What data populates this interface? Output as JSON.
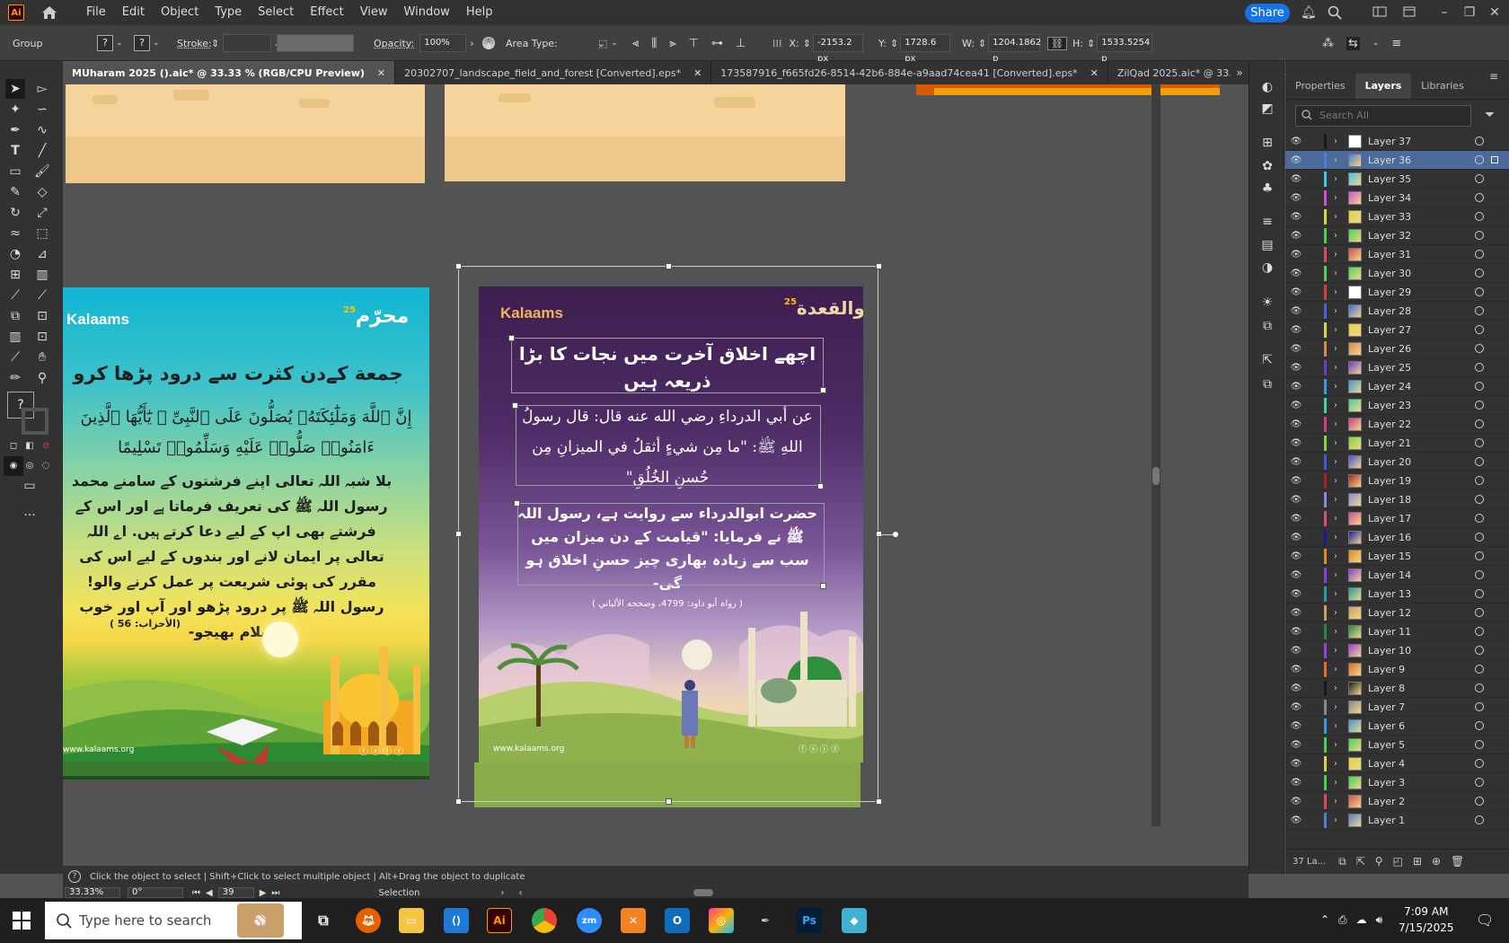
{
  "app": {
    "logo": "Ai",
    "share_label": "Share"
  },
  "menu": [
    "File",
    "Edit",
    "Object",
    "Type",
    "Select",
    "Effect",
    "View",
    "Window",
    "Help"
  ],
  "control": {
    "selection_type": "Group",
    "stroke_label": "Stroke:",
    "opacity_label": "Opacity:",
    "opacity_value": "100%",
    "area_type_label": "Area Type:",
    "x_label": "X:",
    "x_value": "-2153.2 px",
    "y_label": "Y:",
    "y_value": "1728.6 px",
    "w_label": "W:",
    "w_value": "1204.1862 p",
    "h_label": "H:",
    "h_value": "1533.5254 p"
  },
  "tabs": [
    {
      "label": "MUharam 2025 ().aic* @ 33.33 % (RGB/CPU Preview)",
      "active": true
    },
    {
      "label": "20302707_landscape_field_and_forest [Converted].eps*",
      "active": false
    },
    {
      "label": "173587916_f665fd26-8514-42b6-884e-a9aad74cea41 [Converted].eps*",
      "active": false
    },
    {
      "label": "ZilQad 2025.aic* @ 33.33 % (RGB/CPU",
      "active": false
    }
  ],
  "panel": {
    "tabs": [
      "Properties",
      "Layers",
      "Libraries"
    ],
    "active_tab": "Layers",
    "search_placeholder": "Search All",
    "footer_count": "37 La...",
    "layers": [
      {
        "name": "Layer 37",
        "color": "#1a1a1a",
        "selected": false
      },
      {
        "name": "Layer 36",
        "color": "#4f7fd6",
        "selected": true
      },
      {
        "name": "Layer 35",
        "color": "#3ec7e0",
        "selected": false
      },
      {
        "name": "Layer 34",
        "color": "#d64fd6",
        "selected": false
      },
      {
        "name": "Layer 33",
        "color": "#e0d23e",
        "selected": false
      },
      {
        "name": "Layer 32",
        "color": "#3ed64f",
        "selected": false
      },
      {
        "name": "Layer 31",
        "color": "#d64f4f",
        "selected": false
      },
      {
        "name": "Layer 30",
        "color": "#4fd64f",
        "selected": false
      },
      {
        "name": "Layer 29",
        "color": "#d63e3e",
        "selected": false
      },
      {
        "name": "Layer 28",
        "color": "#3e6ad6",
        "selected": false
      },
      {
        "name": "Layer 27",
        "color": "#e0d23e",
        "selected": false
      },
      {
        "name": "Layer 26",
        "color": "#d6884f",
        "selected": false
      },
      {
        "name": "Layer 25",
        "color": "#6a3ed6",
        "selected": false
      },
      {
        "name": "Layer 24",
        "color": "#3e9ad6",
        "selected": false
      },
      {
        "name": "Layer 23",
        "color": "#3ed6a0",
        "selected": false
      },
      {
        "name": "Layer 22",
        "color": "#d63e88",
        "selected": false
      },
      {
        "name": "Layer 21",
        "color": "#7ad63e",
        "selected": false
      },
      {
        "name": "Layer 20",
        "color": "#3e5ad6",
        "selected": false
      },
      {
        "name": "Layer 19",
        "color": "#b02020",
        "selected": false
      },
      {
        "name": "Layer 18",
        "color": "#8888e0",
        "selected": false
      },
      {
        "name": "Layer 17",
        "color": "#d64f88",
        "selected": false
      },
      {
        "name": "Layer 16",
        "color": "#1a1aa0",
        "selected": false
      },
      {
        "name": "Layer 15",
        "color": "#e08a20",
        "selected": false
      },
      {
        "name": "Layer 14",
        "color": "#8a3ed6",
        "selected": false
      },
      {
        "name": "Layer 13",
        "color": "#20a0a0",
        "selected": false
      },
      {
        "name": "Layer 12",
        "color": "#c8a060",
        "selected": false
      },
      {
        "name": "Layer 11",
        "color": "#208a40",
        "selected": false
      },
      {
        "name": "Layer 10",
        "color": "#a03ed6",
        "selected": false
      },
      {
        "name": "Layer 9",
        "color": "#e07020",
        "selected": false
      },
      {
        "name": "Layer 8",
        "color": "#1a1a1a",
        "selected": false
      },
      {
        "name": "Layer 7",
        "color": "#888888",
        "selected": false
      },
      {
        "name": "Layer 6",
        "color": "#3e9ad6",
        "selected": false
      },
      {
        "name": "Layer 5",
        "color": "#3ed64f",
        "selected": false
      },
      {
        "name": "Layer 4",
        "color": "#e0d23e",
        "selected": false
      },
      {
        "name": "Layer 3",
        "color": "#3ed64f",
        "selected": false
      },
      {
        "name": "Layer 2",
        "color": "#d64f4f",
        "selected": false
      },
      {
        "name": "Layer 1",
        "color": "#4f7fd6",
        "selected": false
      }
    ]
  },
  "status": {
    "hint": "Click the object to select  |  Shift+Click to select multiple object  |  Alt+Drag the object to duplicate",
    "zoom": "33.33%",
    "rotation": "0°",
    "artboard": "39",
    "tool": "Selection"
  },
  "taskbar": {
    "search_placeholder": "Type here to search",
    "time": "7:09 AM",
    "date": "7/15/2025"
  },
  "artboard_left": {
    "brand": "Kalaams",
    "heading": "جمعة کےدن کثرت سے درود پڑھا کرو",
    "ayah": "إِنَّ ٱللَّهَ وَمَلَٰٓئِكَتَهُۥ يُصَلُّونَ عَلَى ٱلنَّبِىِّ ۚ يَٰٓأَيُّهَا ٱلَّذِينَ ءَامَنُوا۟ صَلُّوا۟ عَلَيْهِ وَسَلِّمُوا۟ تَسْلِيمًا",
    "body": "بلا شبہ اللہ تعالی اپنے فرشتوں کے سامنے محمد رسول اللہ ﷺ کی تعریف فرماتا ہے اور اس کے فرشتے بھی اپ کے لیے دعا کرتے ہیں. اے اللہ تعالی پر ایمان لانے اور بندوں کے لیے اس کی مقرر کی ہوئی شریعت پر عمل کرنے والو! رسول اللہ ﷺ پر درود پڑھو اور آپ اور خوب سلام بھیجو-",
    "reference": "(الأحزاب: 56 )",
    "website": "www.kalaams.org"
  },
  "artboard_right": {
    "brand": "Kalaams",
    "heading": "اچھے اخلاق آخرت میں نجات کا بڑا ذریعہ ہیں",
    "hadith_ar": "عن أبي الدرداءِ رضي الله عنه قال: قال رسولُ اللهِ ﷺ: \"ما مِن شيءٍ أثقلُ في الميزانِ مِن حُسنِ الخُلُقِ\"",
    "hadith_ur": "حضرت ابوالدرداء سے روایت ہے، رسول اللہ ﷺ نے فرمایا: \"قیامت کے دن میزان میں سب سے زیادہ بھاری چیز حسنِ اخلاق ہو گی-",
    "reference": "( رواہ أبو داود: 4799، وصححه الألباني )",
    "website": "www.kalaams.org"
  }
}
